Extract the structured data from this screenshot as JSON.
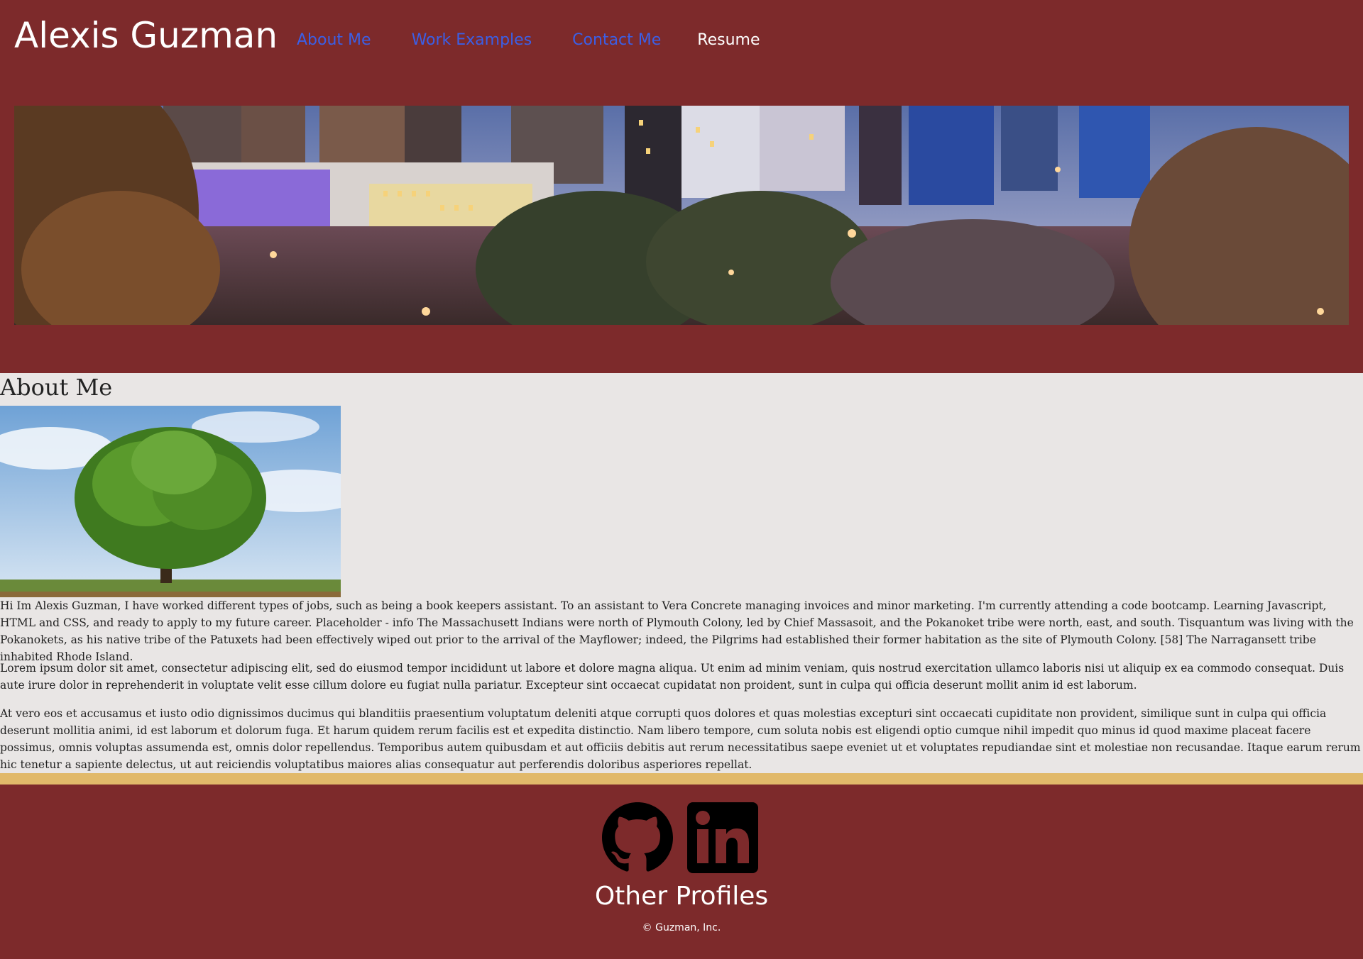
{
  "header": {
    "brand": "Alexis Guzman",
    "nav": [
      {
        "label": "About Me"
      },
      {
        "label": "Work Examples"
      },
      {
        "label": "Contact Me"
      },
      {
        "label": "Resume"
      }
    ]
  },
  "about": {
    "title": "About Me",
    "paragraphs": [
      "Hi Im Alexis Guzman, I have worked different types of jobs, such as being a book keepers assistant. To an assistant to Vera Concrete managing invoices and minor marketing. I'm currently attending a code bootcamp. Learning Javascript, HTML and CSS, and ready to apply to my future career. Placeholder - info The Massachusett Indians were north of Plymouth Colony, led by Chief Massasoit, and the Pokanoket tribe were north, east, and south. Tisquantum was living with the Pokanokets, as his native tribe of the Patuxets had been effectively wiped out prior to the arrival of the Mayflower; indeed, the Pilgrims had established their former habitation as the site of Plymouth Colony. [58] The Narragansett tribe inhabited Rhode Island.",
      "Lorem ipsum dolor sit amet, consectetur adipiscing elit, sed do eiusmod tempor incididunt ut labore et dolore magna aliqua. Ut enim ad minim veniam, quis nostrud exercitation ullamco laboris nisi ut aliquip ex ea commodo consequat. Duis aute irure dolor in reprehenderit in voluptate velit esse cillum dolore eu fugiat nulla pariatur. Excepteur sint occaecat cupidatat non proident, sunt in culpa qui officia deserunt mollit anim id est laborum.",
      "At vero eos et accusamus et iusto odio dignissimos ducimus qui blanditiis praesentium voluptatum deleniti atque corrupti quos dolores et quas molestias excepturi sint occaecati cupiditate non provident, similique sunt in culpa qui officia deserunt mollitia animi, id est laborum et dolorum fuga. Et harum quidem rerum facilis est et expedita distinctio. Nam libero tempore, cum soluta nobis est eligendi optio cumque nihil impedit quo minus id quod maxime placeat facere possimus, omnis voluptas assumenda est, omnis dolor repellendus. Temporibus autem quibusdam et aut officiis debitis aut rerum necessitatibus saepe eveniet ut et voluptates repudiandae sint et molestiae non recusandae. Itaque earum rerum hic tenetur a sapiente delectus, ut aut reiciendis voluptatibus maiores alias consequatur aut perferendis doloribus asperiores repellat."
    ]
  },
  "footer": {
    "icons": [
      "github-icon",
      "linkedin-icon"
    ],
    "heading": "Other Profiles",
    "copyright": "© Guzman, Inc."
  },
  "colors": {
    "header_bg": "#7d2a2b",
    "nav_link": "#3b5fe6",
    "nav_current": "#ffffff",
    "content_bg": "#e9e6e5",
    "stripe": "#e1b96a"
  }
}
